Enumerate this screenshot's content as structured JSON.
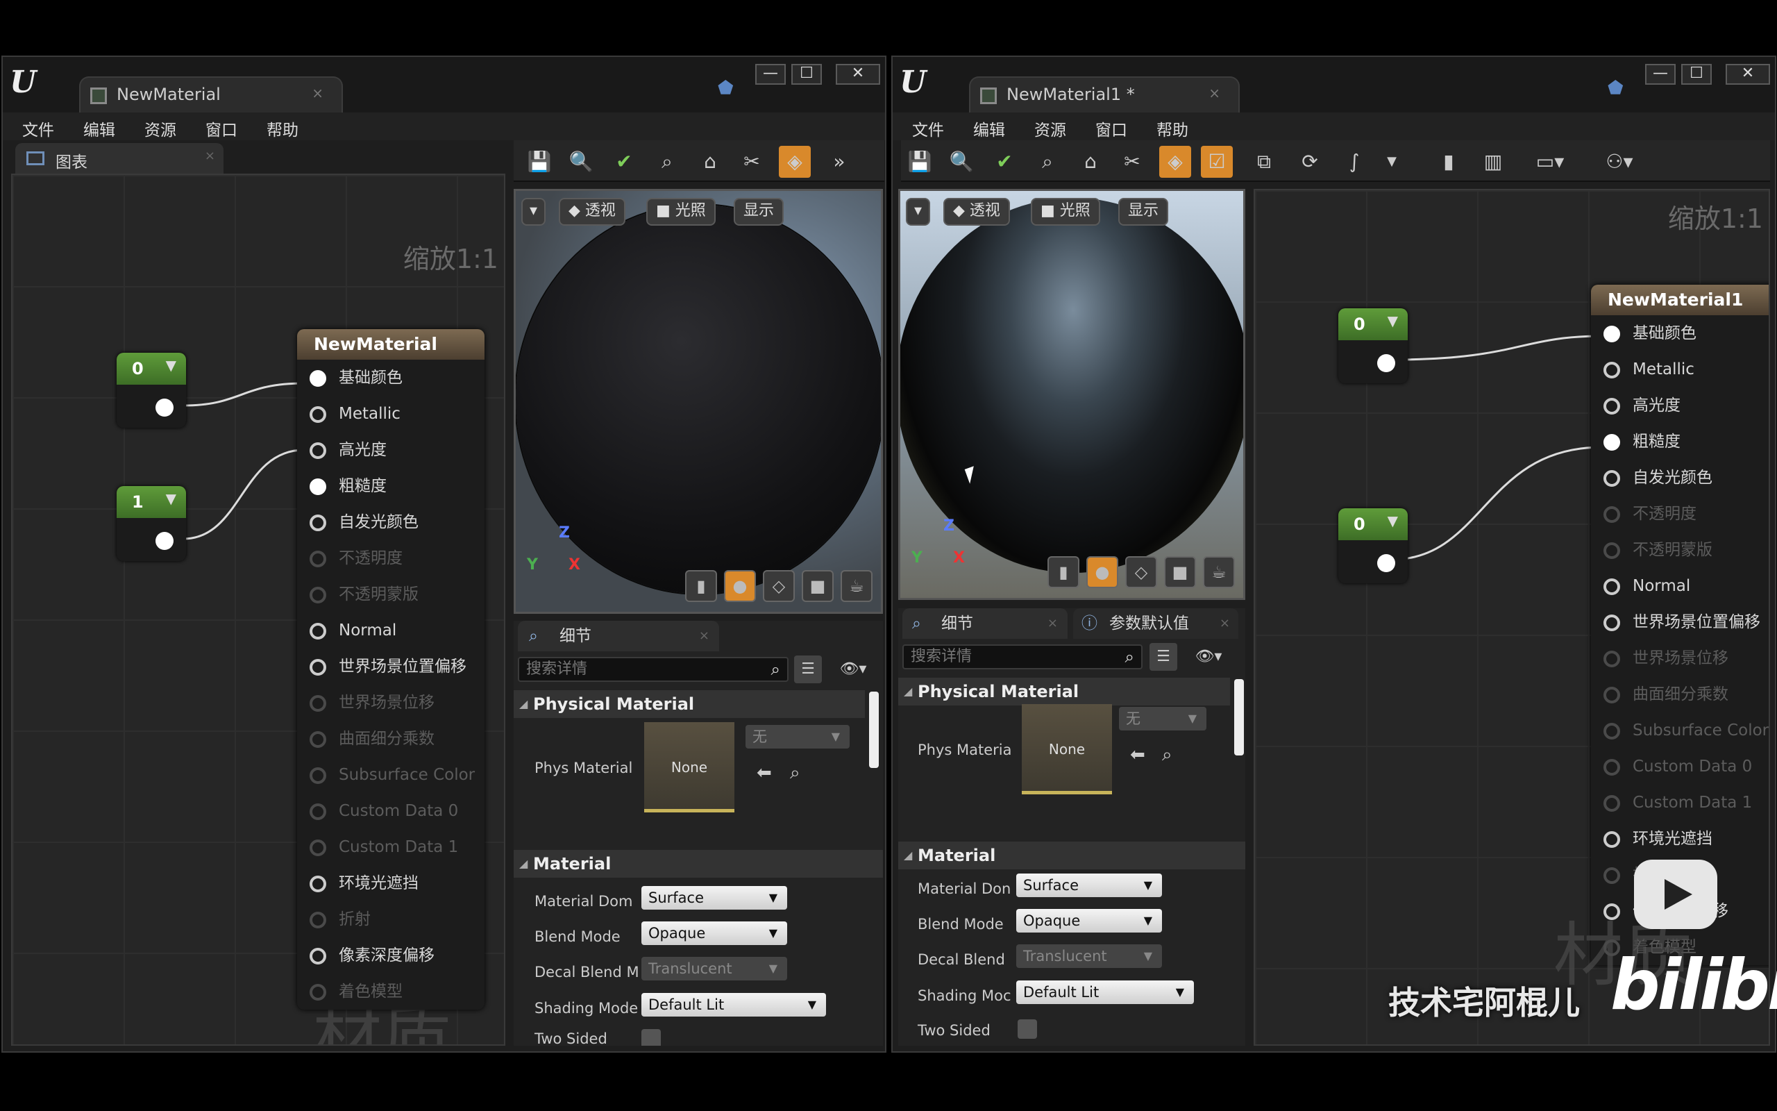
{
  "left_window": {
    "tab_title": "NewMaterial",
    "menu": [
      "文件",
      "编辑",
      "资源",
      "窗口",
      "帮助"
    ],
    "graph_tab": "图表",
    "zoom": "缩放1:1",
    "watermark": "材质",
    "constants": [
      "0",
      "1"
    ],
    "node": {
      "title": "NewMaterial",
      "pins": [
        {
          "label": "基础颜色",
          "state": "on"
        },
        {
          "label": "Metallic",
          "state": "off"
        },
        {
          "label": "高光度",
          "state": "off"
        },
        {
          "label": "粗糙度",
          "state": "on"
        },
        {
          "label": "自发光颜色",
          "state": "off"
        },
        {
          "label": "不透明度",
          "state": "dim"
        },
        {
          "label": "不透明蒙版",
          "state": "dim"
        },
        {
          "label": "Normal",
          "state": "off"
        },
        {
          "label": "世界场景位置偏移",
          "state": "off"
        },
        {
          "label": "世界场景位移",
          "state": "dim"
        },
        {
          "label": "曲面细分乘数",
          "state": "dim"
        },
        {
          "label": "Subsurface Color",
          "state": "dim"
        },
        {
          "label": "Custom Data 0",
          "state": "dim"
        },
        {
          "label": "Custom Data 1",
          "state": "dim"
        },
        {
          "label": "环境光遮挡",
          "state": "off"
        },
        {
          "label": "折射",
          "state": "dim"
        },
        {
          "label": "像素深度偏移",
          "state": "off"
        },
        {
          "label": "着色模型",
          "state": "dim"
        }
      ]
    },
    "viewport_buttons": [
      "透视",
      "光照",
      "显示"
    ],
    "details_tab": "细节",
    "search_placeholder": "搜索详情",
    "physical_material": "Physical Material",
    "phys_material_label": "Phys Material",
    "thumb": "None",
    "phys_value": "无",
    "material_section": "Material",
    "props": [
      {
        "label": "Material Dom",
        "value": "Surface"
      },
      {
        "label": "Blend Mode",
        "value": "Opaque"
      },
      {
        "label": "Decal Blend M",
        "value": "Translucent"
      },
      {
        "label": "Shading Mode",
        "value": "Default Lit"
      },
      {
        "label": "Two Sided",
        "value": ""
      }
    ]
  },
  "right_window": {
    "tab_title": "NewMaterial1 *",
    "menu": [
      "文件",
      "编辑",
      "资源",
      "窗口",
      "帮助"
    ],
    "zoom": "缩放1:1",
    "constants": [
      "0",
      "0"
    ],
    "node": {
      "title": "NewMaterial1"
    },
    "viewport_buttons": [
      "透视",
      "光照",
      "显示"
    ],
    "details_tab": "细节",
    "params_tab": "参数默认值",
    "search_placeholder": "搜索详情",
    "physical_material": "Physical Material",
    "phys_material_label": "Phys Materia",
    "thumb": "None",
    "phys_value": "无",
    "material_section": "Material",
    "props": [
      {
        "label": "Material Don",
        "value": "Surface"
      },
      {
        "label": "Blend Mode",
        "value": "Opaque"
      },
      {
        "label": "Decal Blend",
        "value": "Translucent"
      },
      {
        "label": "Shading Moc",
        "value": "Default Lit"
      },
      {
        "label": "Two Sided",
        "value": ""
      }
    ]
  },
  "overlay": {
    "author": "技术宅阿棍儿",
    "logo": "bilibili"
  },
  "colors": {
    "accent": "#d9892b",
    "pin_node_header": "#7d6a52",
    "constant_header": "#5f9c3a"
  }
}
